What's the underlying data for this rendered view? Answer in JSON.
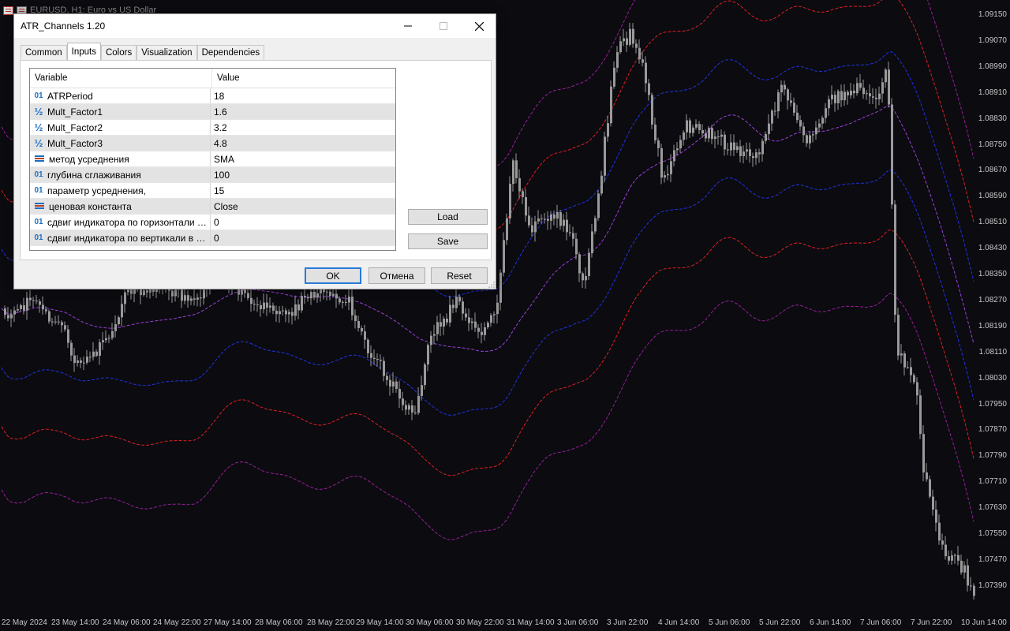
{
  "chart": {
    "title": "EURUSD, H1: Euro vs US Dollar",
    "price_labels": [
      "1.09150",
      "1.09070",
      "1.08990",
      "1.08910",
      "1.08830",
      "1.08750",
      "1.08670",
      "1.08590",
      "1.08510",
      "1.08430",
      "1.08350",
      "1.08270",
      "1.08190",
      "1.08110",
      "1.08030",
      "1.07950",
      "1.07870",
      "1.07790",
      "1.07710",
      "1.07630",
      "1.07550",
      "1.07470",
      "1.07390"
    ],
    "time_labels": [
      "22 May 2024",
      "23 May 14:00",
      "24 May 06:00",
      "24 May 22:00",
      "27 May 14:00",
      "28 May 06:00",
      "28 May 22:00",
      "29 May 14:00",
      "30 May 06:00",
      "30 May 22:00",
      "31 May 14:00",
      "3 Jun 06:00",
      "3 Jun 22:00",
      "4 Jun 14:00",
      "5 Jun 06:00",
      "5 Jun 22:00",
      "6 Jun 14:00",
      "7 Jun 06:00",
      "7 Jun 22:00",
      "10 Jun 14:00"
    ],
    "colors": {
      "background": "#0b0b10",
      "candles": "#9a9a9a",
      "middle_line": "#9b40d8",
      "band1": "#2233dd",
      "band2": "#e02020",
      "band3": "#9a1e9a"
    }
  },
  "dialog": {
    "title": "ATR_Channels 1.20",
    "tabs": [
      "Common",
      "Inputs",
      "Colors",
      "Visualization",
      "Dependencies"
    ],
    "active_tab": "Inputs",
    "columns": {
      "variable": "Variable",
      "value": "Value"
    },
    "params": [
      {
        "icon": "int-icon",
        "name": "ATRPeriod",
        "value": "18"
      },
      {
        "icon": "double-icon",
        "name": "Mult_Factor1",
        "value": "1.6"
      },
      {
        "icon": "double-icon",
        "name": "Mult_Factor2",
        "value": "3.2"
      },
      {
        "icon": "double-icon",
        "name": "Mult_Factor3",
        "value": "4.8"
      },
      {
        "icon": "enum-icon",
        "name": "метод усреднения",
        "value": "SMA"
      },
      {
        "icon": "int-icon",
        "name": "глубина  сглаживания",
        "value": "100"
      },
      {
        "icon": "int-icon",
        "name": "параметр усреднения,",
        "value": "15"
      },
      {
        "icon": "enum-icon",
        "name": "ценовая константа",
        "value": "Close"
      },
      {
        "icon": "int-icon",
        "name": "сдвиг индикатора по горизонтали в б...",
        "value": "0"
      },
      {
        "icon": "int-icon",
        "name": "сдвиг индикатора по вертикали в пу...",
        "value": "0"
      }
    ],
    "icon_glyphs": {
      "int": "01",
      "double": "½"
    },
    "buttons": {
      "load": "Load",
      "save": "Save",
      "ok": "OK",
      "cancel": "Отмена",
      "reset": "Reset"
    }
  }
}
